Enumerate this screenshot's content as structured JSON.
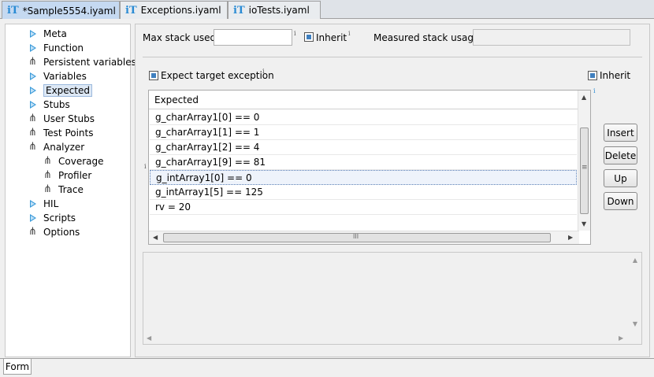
{
  "tabs": [
    {
      "label": "*Sample5554.iyaml",
      "icon": "iT",
      "active": true,
      "closable": true
    },
    {
      "label": "Exceptions.iyaml",
      "icon": "iT",
      "active": false
    },
    {
      "label": "ioTests.iyaml",
      "icon": "iT",
      "active": false
    }
  ],
  "tree": [
    {
      "label": "Meta",
      "icon": "triangle-icon"
    },
    {
      "label": "Function",
      "icon": "triangle-icon"
    },
    {
      "label": "Persistent variables",
      "icon": "fork-icon"
    },
    {
      "label": "Variables",
      "icon": "triangle-icon"
    },
    {
      "label": "Expected",
      "icon": "triangle-icon",
      "selected": true
    },
    {
      "label": "Stubs",
      "icon": "triangle-icon"
    },
    {
      "label": "User Stubs",
      "icon": "fork-icon"
    },
    {
      "label": "Test Points",
      "icon": "fork-icon"
    },
    {
      "label": "Analyzer",
      "icon": "fork-icon"
    },
    {
      "label": "Coverage",
      "icon": "fork-icon"
    },
    {
      "label": "Profiler",
      "icon": "fork-icon"
    },
    {
      "label": "Trace",
      "icon": "fork-icon"
    },
    {
      "label": "HIL",
      "icon": "triangle-icon"
    },
    {
      "label": "Scripts",
      "icon": "triangle-icon"
    },
    {
      "label": "Options",
      "icon": "fork-icon"
    }
  ],
  "stack": {
    "max_label": "Max stack used:",
    "max_value": "",
    "inherit_label": "Inherit",
    "measured_label": "Measured stack usage:",
    "measured_value": "",
    "info_glyph": "i"
  },
  "expect": {
    "target_exception_label": "Expect target exception",
    "inherit_label": "Inherit"
  },
  "table": {
    "header": "Expected",
    "rows": [
      "g_charArray1[0] == 0",
      "g_charArray1[1] == 1",
      "g_charArray1[2] == 4",
      "g_charArray1[9] == 81",
      "g_intArray1[0] == 0",
      "g_intArray1[5] == 125",
      "rv = 20"
    ],
    "selected_index": 4,
    "hscroll_grip": "III",
    "vscroll_grip": "≡"
  },
  "buttons": {
    "insert": "Insert",
    "delete": "Delete",
    "up": "Up",
    "down": "Down"
  },
  "bottom_tab": "Form",
  "colors": {
    "tab_active": "#c5d9f1",
    "icon_blue": "#2a8bd4",
    "checkbox": "#3f7fbf"
  }
}
